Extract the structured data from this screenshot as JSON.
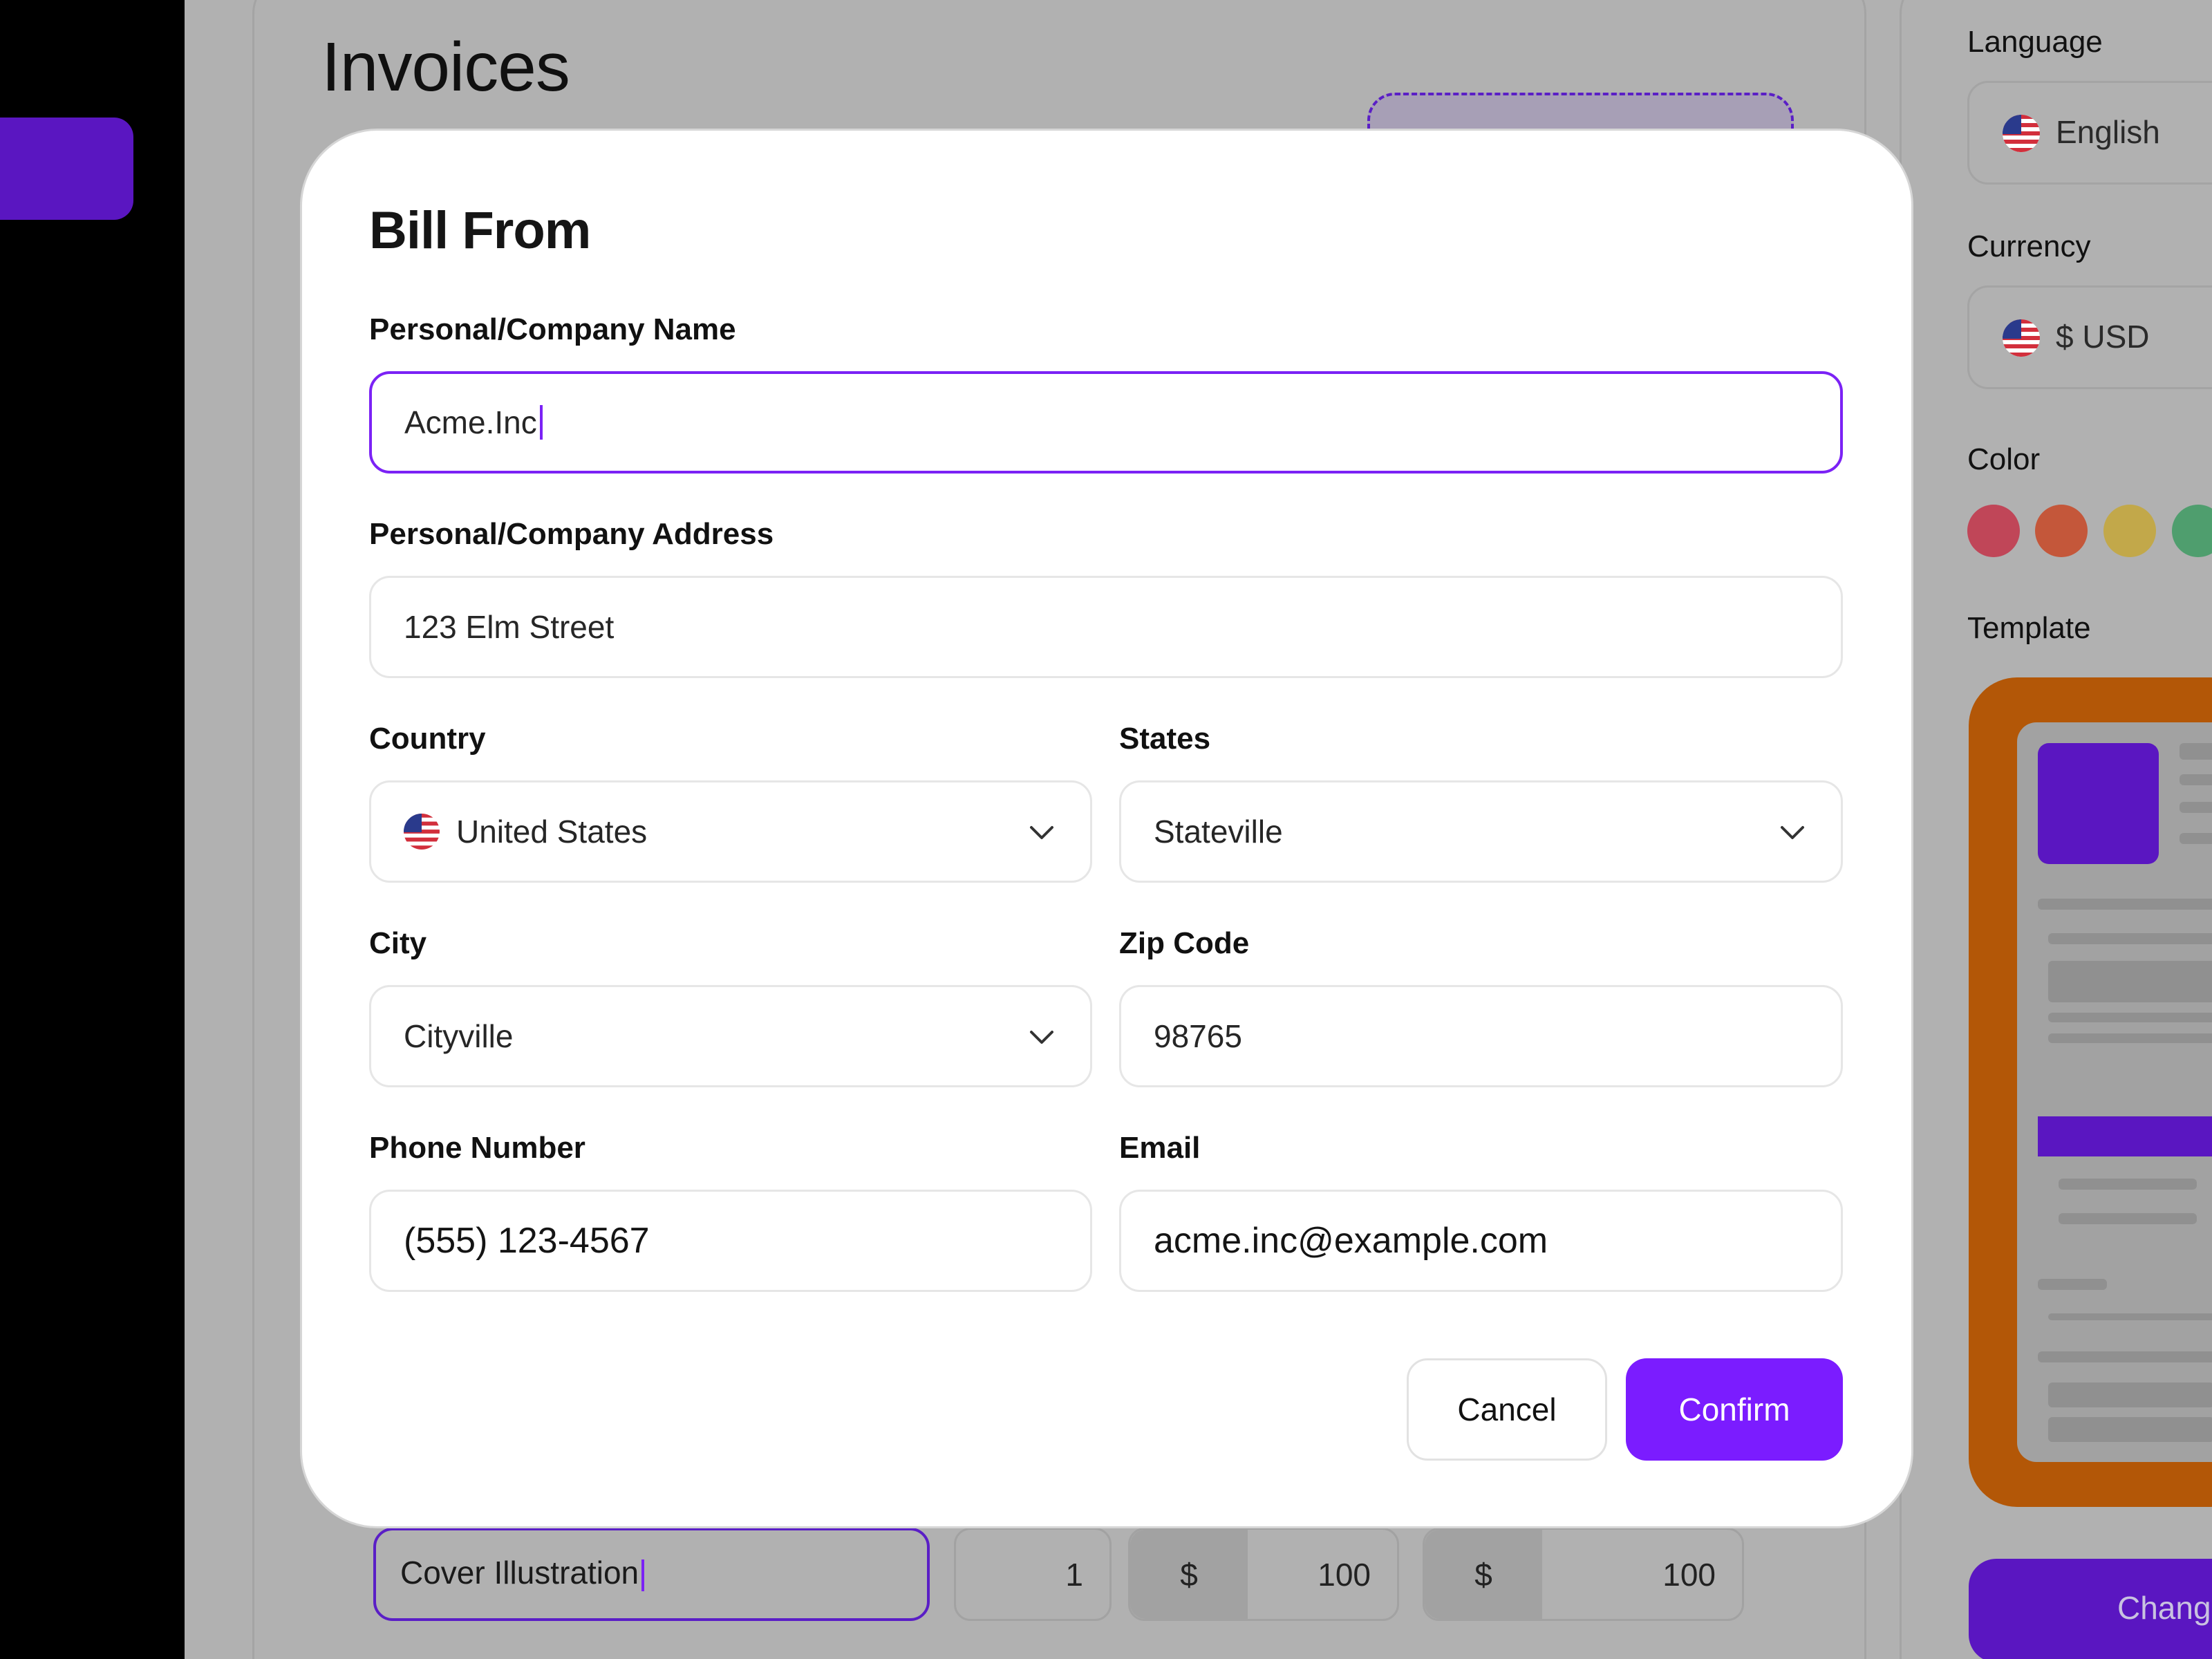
{
  "background": {
    "page_title": "Invoices",
    "line_item": {
      "description": "Cover Illustration",
      "quantity": "1",
      "currency_symbol": "$",
      "rate": "100",
      "amount": "100"
    }
  },
  "settings": {
    "language_label": "Language",
    "language_value": "English",
    "currency_label": "Currency",
    "currency_value": "$ USD",
    "color_label": "Color",
    "colors": [
      "#c04658",
      "#c4573a",
      "#c2a84a",
      "#4f9e6e"
    ],
    "template_label": "Template",
    "change_button": "Chang"
  },
  "modal": {
    "title": "Bill From",
    "name_label": "Personal/Company Name",
    "name_value": "Acme.Inc",
    "address_label": "Personal/Company Address",
    "address_value": "123 Elm Street",
    "country_label": "Country",
    "country_value": "United States",
    "states_label": "States",
    "states_value": "Stateville",
    "city_label": "City",
    "city_value": "Cityville",
    "zip_label": "Zip Code",
    "zip_value": "98765",
    "phone_label": "Phone Number",
    "phone_value": "(555) 123-4567",
    "email_label": "Email",
    "email_value": "acme.inc@example.com",
    "cancel_label": "Cancel",
    "confirm_label": "Confirm"
  },
  "icons": {
    "flag": "us-flag-icon",
    "dropdown": "chevron-down-icon"
  },
  "colors": {
    "accent": "#7b1cff",
    "sidebar": "#000000",
    "template_card": "#b35707"
  }
}
